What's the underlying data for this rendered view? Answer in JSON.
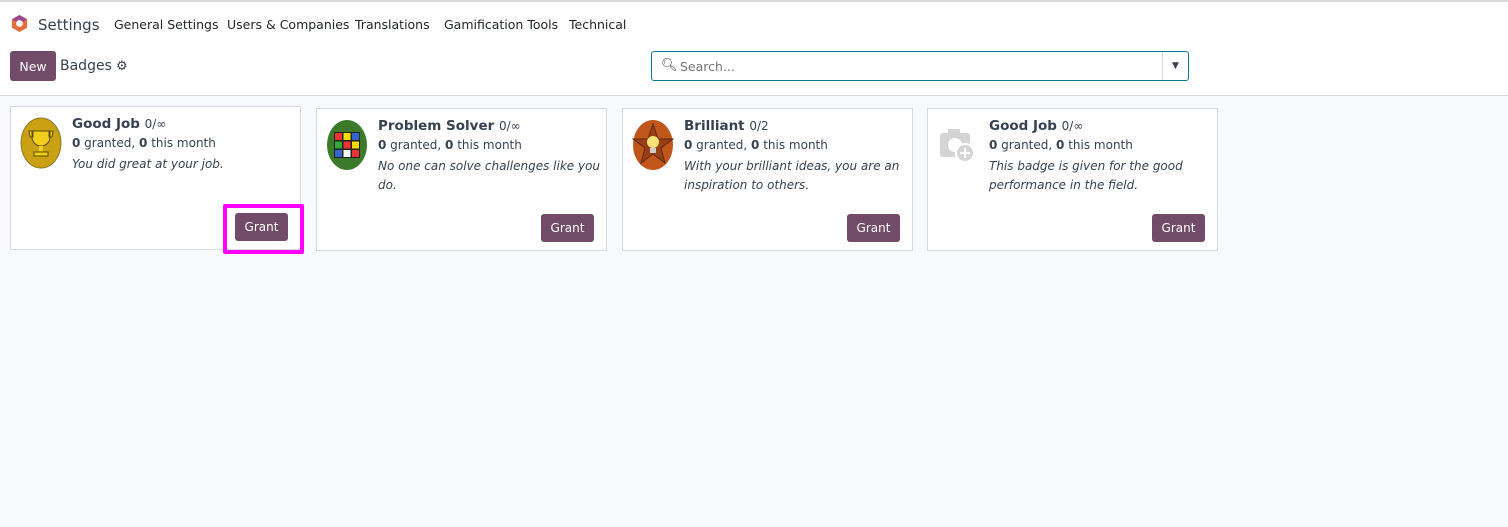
{
  "app": {
    "title": "Settings",
    "menu": [
      "General Settings",
      "Users & Companies",
      "Translations",
      "Gamification Tools",
      "Technical"
    ]
  },
  "control": {
    "new_label": "New",
    "breadcrumb": "Badges",
    "search_placeholder": "Search..."
  },
  "cards": [
    {
      "name": "Good Job",
      "limit": "0/∞",
      "granted": "0",
      "granted_label": " granted, ",
      "month": "0",
      "month_label": " this month",
      "desc": "You did great at your job.",
      "icon": "trophy-icon",
      "grant": "Grant"
    },
    {
      "name": "Problem Solver",
      "limit": "0/∞",
      "granted": "0",
      "granted_label": " granted, ",
      "month": "0",
      "month_label": " this month",
      "desc": "No one can solve challenges like you do.",
      "icon": "rubiks-cube-icon",
      "grant": "Grant"
    },
    {
      "name": "Brilliant",
      "limit": "0/2",
      "granted": "0",
      "granted_label": " granted, ",
      "month": "0",
      "month_label": " this month",
      "desc": "With your brilliant ideas, you are an inspiration to others.",
      "icon": "lightbulb-star-icon",
      "grant": "Grant"
    },
    {
      "name": "Good Job",
      "limit": "0/∞",
      "granted": "0",
      "granted_label": " granted, ",
      "month": "0",
      "month_label": " this month",
      "desc": "This badge is given for the good performance in the field.",
      "icon": "camera-placeholder-icon",
      "grant": "Grant"
    }
  ],
  "colors": {
    "primary": "#714b67",
    "highlight": "#ff00ff"
  }
}
